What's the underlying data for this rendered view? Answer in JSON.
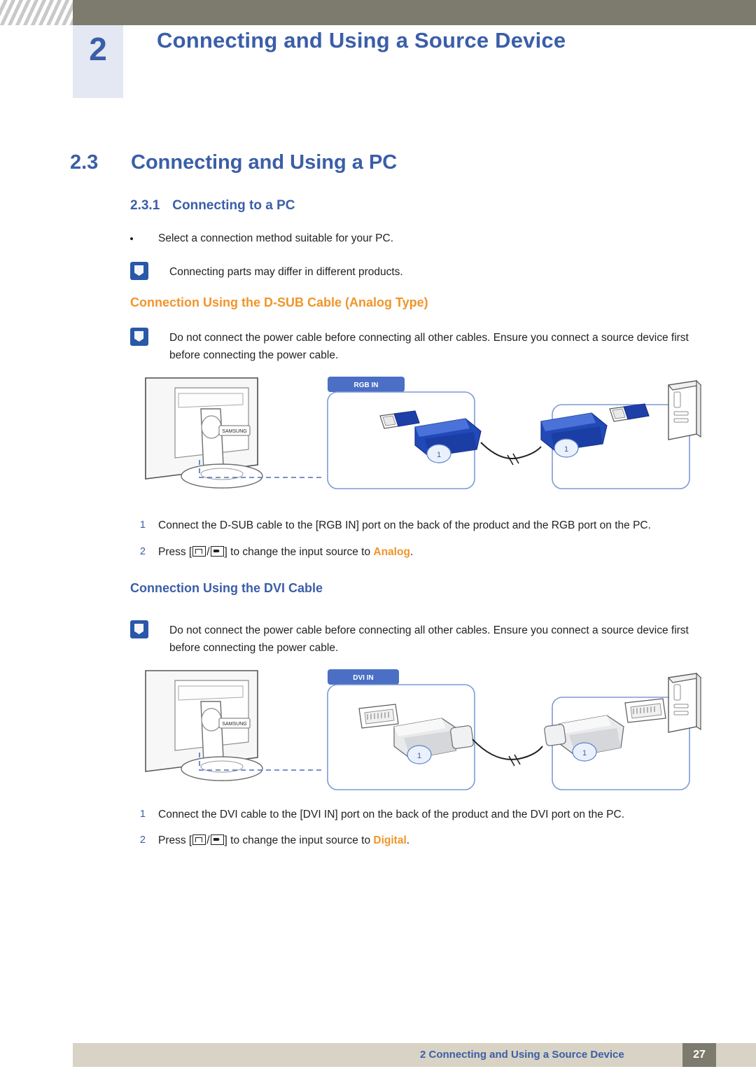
{
  "header": {
    "chapter_number": "2",
    "title": "Connecting and Using a Source Device"
  },
  "section": {
    "number": "2.3",
    "title": "Connecting and Using a PC"
  },
  "subsection": {
    "number": "2.3.1",
    "title": "Connecting to a PC"
  },
  "bullets": [
    "Select a connection method suitable for your PC."
  ],
  "notes": {
    "intro": "Connecting parts may differ in different products.",
    "dsub": "Do not connect the power cable before connecting all other cables. Ensure you connect a source device first before connecting the power cable.",
    "dvi": "Do not connect the power cable before connecting all other cables. Ensure you connect a source device first before connecting the power cable."
  },
  "dsub_section": {
    "heading": "Connection Using the D-SUB Cable (Analog Type)",
    "port_label": "RGB IN",
    "monitor_brand": "SAMSUNG",
    "steps": [
      {
        "num": "1",
        "text": "Connect the D-SUB cable to the [RGB IN] port on the back of the product and the RGB port on the PC."
      },
      {
        "num": "2",
        "prefix": "Press [",
        "middle": "/",
        "suffix": "] to change the input source to ",
        "keyword": "Analog",
        "end": "."
      }
    ]
  },
  "dvi_section": {
    "heading": "Connection Using the DVI Cable",
    "port_label": "DVI IN",
    "monitor_brand": "SAMSUNG",
    "steps": [
      {
        "num": "1",
        "text": "Connect the DVI cable to the [DVI IN] port on the back of the product and the DVI port on the PC."
      },
      {
        "num": "2",
        "prefix": "Press [",
        "middle": "/",
        "suffix": "] to change the input source to ",
        "keyword": "Digital",
        "end": "."
      }
    ]
  },
  "footer": {
    "text": "2 Connecting and Using a Source Device",
    "page": "27"
  },
  "colors": {
    "accent_blue": "#3b5ea8",
    "accent_orange": "#f0952b",
    "header_bar": "#7d7a6e",
    "footer_bar": "#d8d3c4",
    "chapter_box": "#e3e8f2",
    "cable_blue": "#1f3fa8"
  }
}
